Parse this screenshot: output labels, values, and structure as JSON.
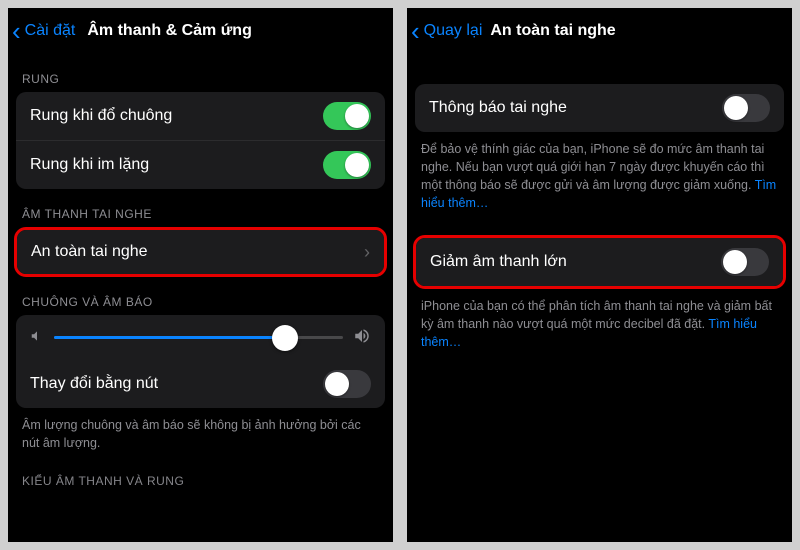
{
  "left": {
    "back": "Cài đặt",
    "title": "Âm thanh & Cảm ứng",
    "sections": {
      "vibration_header": "RUNG",
      "vibrate_ring": "Rung khi đổ chuông",
      "vibrate_silent": "Rung khi im lặng",
      "headphone_audio_header": "ÂM THANH TAI NGHE",
      "headphone_safety": "An toàn tai nghe",
      "ringer_header": "CHUÔNG VÀ ÂM BÁO",
      "change_with_buttons": "Thay đổi bằng nút",
      "ringer_footer": "Âm lượng chuông và âm báo sẽ không bị ảnh hưởng bởi các nút âm lượng.",
      "sounds_patterns_header": "KIỂU ÂM THANH VÀ RUNG"
    },
    "toggles": {
      "vibrate_ring": true,
      "vibrate_silent": true,
      "change_with_buttons": false
    },
    "slider_value": 80
  },
  "right": {
    "back": "Quay lại",
    "title": "An toàn tai nghe",
    "rows": {
      "headphone_notifications": "Thông báo tai nghe",
      "reduce_loud": "Giảm âm thanh lớn"
    },
    "toggles": {
      "headphone_notifications": false,
      "reduce_loud": false
    },
    "footers": {
      "notifications": "Để bảo vệ thính giác của bạn, iPhone sẽ đo mức âm thanh tai nghe. Nếu bạn vượt quá giới hạn 7 ngày được khuyến cáo thì một thông báo sẽ được gửi và âm lượng được giảm xuống. ",
      "notifications_link": "Tìm hiểu thêm…",
      "reduce": "iPhone của bạn có thể phân tích âm thanh tai nghe và giảm bất kỳ âm thanh nào vượt quá một mức decibel đã đặt. ",
      "reduce_link": "Tìm hiểu thêm…"
    }
  }
}
